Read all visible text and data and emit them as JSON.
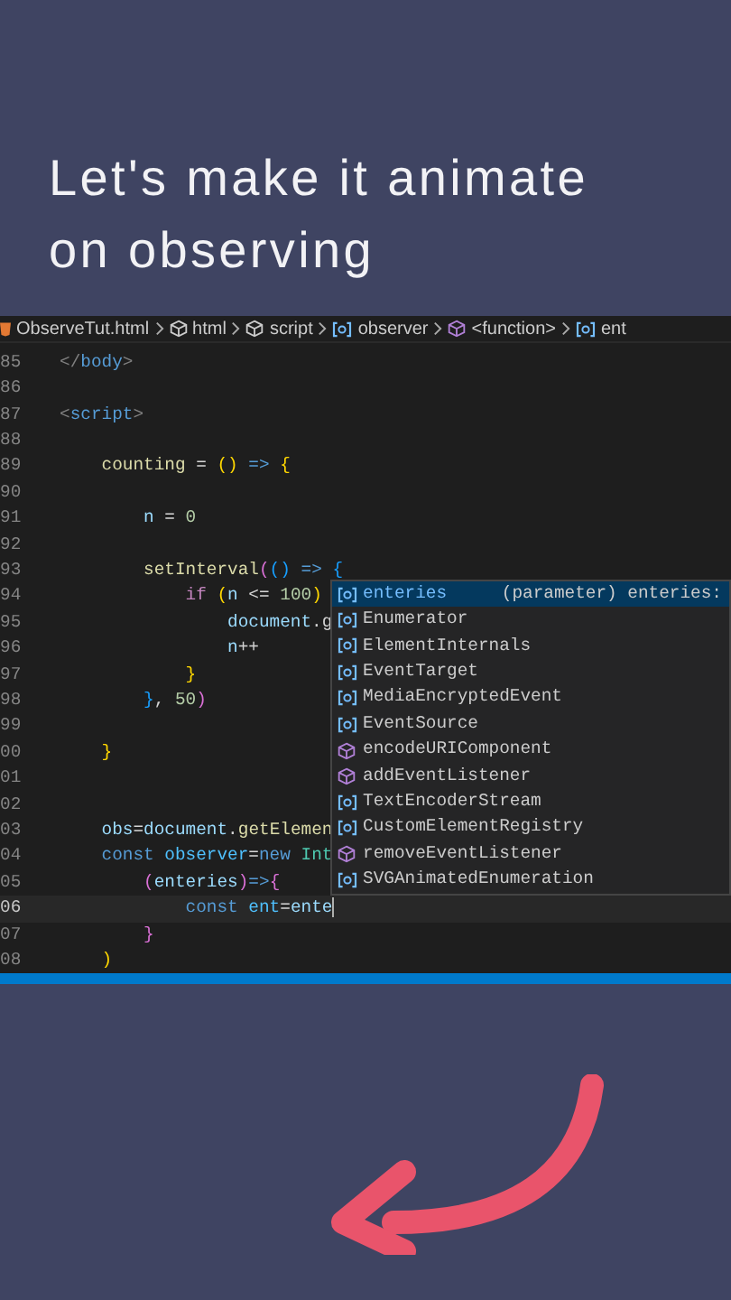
{
  "title": "Let's make it animate\non observing",
  "breadcrumb": [
    {
      "kind": "file",
      "label": "ObserveTut.html"
    },
    {
      "kind": "element",
      "label": "html"
    },
    {
      "kind": "element",
      "label": "script"
    },
    {
      "kind": "variable",
      "label": "observer"
    },
    {
      "kind": "function",
      "label": "<function>"
    },
    {
      "kind": "variable",
      "label": "ent"
    }
  ],
  "lines": [
    {
      "number": "85",
      "current": false,
      "tokens": [
        {
          "text": "</",
          "kind": "tagp"
        },
        {
          "text": "body",
          "kind": "tag"
        },
        {
          "text": ">",
          "kind": "tagp"
        }
      ]
    },
    {
      "number": "86",
      "current": false
    },
    {
      "number": "87",
      "current": false,
      "tokens": [
        {
          "text": "<",
          "kind": "tagp"
        },
        {
          "text": "script",
          "kind": "tag"
        },
        {
          "text": ">",
          "kind": "tagp"
        }
      ]
    },
    {
      "number": "88",
      "current": false
    },
    {
      "number": "89",
      "current": false,
      "tokens": [
        {
          "text": "    counting",
          "kind": "func"
        },
        {
          "text": " = ",
          "kind": "punct"
        },
        {
          "text": "()",
          "kind": "b1"
        },
        {
          "text": " => ",
          "kind": "kw"
        },
        {
          "text": "{",
          "kind": "b1"
        }
      ]
    },
    {
      "number": "90",
      "current": false
    },
    {
      "number": "91",
      "current": false,
      "tokens": [
        {
          "text": "        n",
          "kind": "var"
        },
        {
          "text": " = ",
          "kind": "punct"
        },
        {
          "text": "0",
          "kind": "num"
        }
      ]
    },
    {
      "number": "92",
      "current": false
    },
    {
      "number": "93",
      "current": false,
      "tokens": [
        {
          "text": "        setInterval",
          "kind": "func"
        },
        {
          "text": "(",
          "kind": "b2"
        },
        {
          "text": "()",
          "kind": "b3"
        },
        {
          "text": " => ",
          "kind": "kw"
        },
        {
          "text": "{",
          "kind": "b3"
        }
      ]
    },
    {
      "number": "94",
      "current": false,
      "tokens": [
        {
          "text": "            if",
          "kind": "ctrl"
        },
        {
          "text": " (",
          "kind": "b1"
        },
        {
          "text": "n",
          "kind": "var"
        },
        {
          "text": " <= ",
          "kind": "punct"
        },
        {
          "text": "100",
          "kind": "num"
        },
        {
          "text": ")",
          "kind": "b1"
        }
      ]
    },
    {
      "number": "95",
      "current": false,
      "tokens": [
        {
          "text": "                document",
          "kind": "var"
        },
        {
          "text": ".g",
          "kind": "punct"
        }
      ]
    },
    {
      "number": "96",
      "current": false,
      "tokens": [
        {
          "text": "                n",
          "kind": "var"
        },
        {
          "text": "++",
          "kind": "punct"
        }
      ]
    },
    {
      "number": "97",
      "current": false,
      "tokens": [
        {
          "text": "            }",
          "kind": "b1"
        }
      ]
    },
    {
      "number": "98",
      "current": false,
      "tokens": [
        {
          "text": "        }",
          "kind": "b3"
        },
        {
          "text": ", ",
          "kind": "punct"
        },
        {
          "text": "50",
          "kind": "num"
        },
        {
          "text": ")",
          "kind": "b2"
        }
      ]
    },
    {
      "number": "99",
      "current": false
    },
    {
      "number": "00",
      "current": false,
      "tokens": [
        {
          "text": "    }",
          "kind": "b1"
        }
      ]
    },
    {
      "number": "01",
      "current": false
    },
    {
      "number": "02",
      "current": false
    },
    {
      "number": "03",
      "current": false,
      "tokens": [
        {
          "text": "    obs",
          "kind": "var"
        },
        {
          "text": "=",
          "kind": "punct"
        },
        {
          "text": "document",
          "kind": "var"
        },
        {
          "text": ".",
          "kind": "punct"
        },
        {
          "text": "getElemen",
          "kind": "func"
        }
      ]
    },
    {
      "number": "04",
      "current": false,
      "tokens": [
        {
          "text": "    const",
          "kind": "kw"
        },
        {
          "text": " observer",
          "kind": "const"
        },
        {
          "text": "=",
          "kind": "punct"
        },
        {
          "text": "new",
          "kind": "kw"
        },
        {
          "text": " Int",
          "kind": "type"
        }
      ]
    },
    {
      "number": "05",
      "current": false,
      "tokens": [
        {
          "text": "        (",
          "kind": "b2"
        },
        {
          "text": "enteries",
          "kind": "var"
        },
        {
          "text": ")",
          "kind": "b2"
        },
        {
          "text": "=>",
          "kind": "kw"
        },
        {
          "text": "{",
          "kind": "b2"
        }
      ]
    },
    {
      "number": "06",
      "current": true,
      "tokens": [
        {
          "text": "            const",
          "kind": "kw"
        },
        {
          "text": " ent",
          "kind": "const"
        },
        {
          "text": "=",
          "kind": "punct"
        },
        {
          "text": "ente",
          "kind": "var"
        }
      ]
    },
    {
      "number": "07",
      "current": false,
      "tokens": [
        {
          "text": "        }",
          "kind": "b2"
        }
      ]
    },
    {
      "number": "08",
      "current": false,
      "tokens": [
        {
          "text": "    )",
          "kind": "b1"
        }
      ]
    }
  ],
  "suggestions": [
    {
      "kind": "variable",
      "label": "enteries",
      "detail": "(parameter) enteries:",
      "selected": true
    },
    {
      "kind": "variable",
      "label": "Enumerator",
      "selected": false
    },
    {
      "kind": "variable",
      "label": "ElementInternals",
      "selected": false
    },
    {
      "kind": "variable",
      "label": "EventTarget",
      "selected": false
    },
    {
      "kind": "variable",
      "label": "MediaEncryptedEvent",
      "selected": false
    },
    {
      "kind": "variable",
      "label": "EventSource",
      "selected": false
    },
    {
      "kind": "method",
      "label": "encodeURIComponent",
      "selected": false
    },
    {
      "kind": "method",
      "label": "addEventListener",
      "selected": false
    },
    {
      "kind": "variable",
      "label": "TextEncoderStream",
      "selected": false
    },
    {
      "kind": "variable",
      "label": "CustomElementRegistry",
      "selected": false
    },
    {
      "kind": "method",
      "label": "removeEventListener",
      "selected": false
    },
    {
      "kind": "variable",
      "label": "SVGAnimatedEnumeration",
      "selected": false
    }
  ]
}
